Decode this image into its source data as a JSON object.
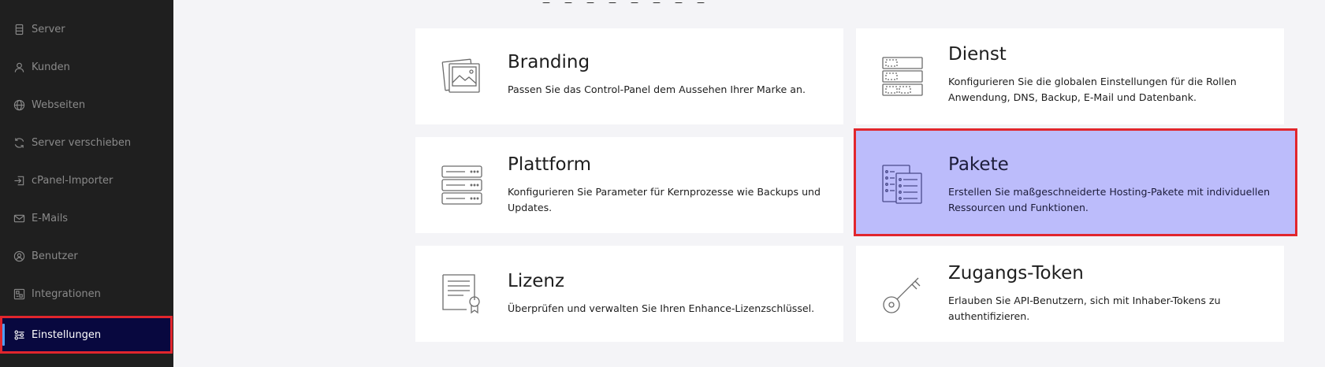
{
  "sidebar": {
    "items": [
      {
        "label": "Server",
        "icon": "server-icon",
        "active": false
      },
      {
        "label": "Kunden",
        "icon": "user-icon",
        "active": false
      },
      {
        "label": "Webseiten",
        "icon": "globe-icon",
        "active": false
      },
      {
        "label": "Server verschieben",
        "icon": "refresh-icon",
        "active": false
      },
      {
        "label": "cPanel-Importer",
        "icon": "import-icon",
        "active": false
      },
      {
        "label": "E-Mails",
        "icon": "mail-icon",
        "active": false
      },
      {
        "label": "Benutzer",
        "icon": "user-circle-icon",
        "active": false
      },
      {
        "label": "Integrationen",
        "icon": "integrations-icon",
        "active": false
      },
      {
        "label": "Einstellungen",
        "icon": "sliders-icon",
        "active": true
      }
    ]
  },
  "cards": {
    "branding": {
      "title": "Branding",
      "description": "Passen Sie das Control-Panel dem Aussehen Ihrer Marke an.",
      "icon": "images-icon"
    },
    "dienst": {
      "title": "Dienst",
      "description": "Konfigurieren Sie die globalen Einstellungen für die Rollen Anwendung, DNS, Backup, E-Mail und Datenbank.",
      "icon": "service-stack-icon"
    },
    "plattform": {
      "title": "Plattform",
      "description": "Konfigurieren Sie Parameter für Kernprozesse wie Backups und Updates.",
      "icon": "server-rack-icon"
    },
    "pakete": {
      "title": "Pakete",
      "description": "Erstellen Sie maßgeschneiderte Hosting-Pakete mit individuellen Ressourcen und Funktionen.",
      "icon": "packages-icon"
    },
    "lizenz": {
      "title": "Lizenz",
      "description": "Überprüfen und verwalten Sie Ihren Enhance-Lizenzschlüssel.",
      "icon": "certificate-icon"
    },
    "zugangs_token": {
      "title": "Zugangs-Token",
      "description": "Erlauben Sie API-Benutzern, sich mit Inhaber-Tokens zu authentifizieren.",
      "icon": "key-icon"
    }
  },
  "colors": {
    "sidebar_bg": "#1f1f1f",
    "active_bg": "#08083f",
    "highlight_bg": "#bcbcfb",
    "highlight_border": "#e1262d",
    "accent": "#4ea0ff"
  }
}
